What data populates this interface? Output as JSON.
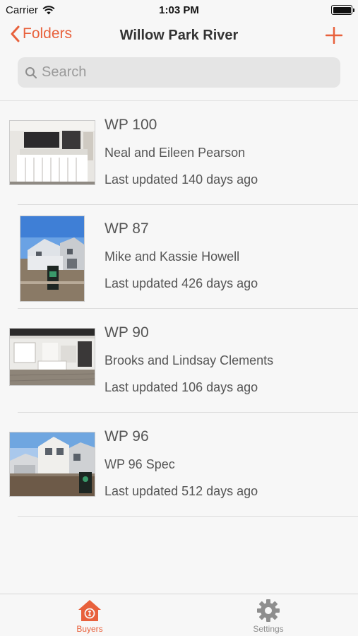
{
  "status_bar": {
    "carrier": "Carrier",
    "time": "1:03 PM"
  },
  "nav": {
    "back_label": "Folders",
    "title": "Willow Park River",
    "accent_color": "#e8613c"
  },
  "search": {
    "placeholder": "Search",
    "value": ""
  },
  "items": [
    {
      "title": "WP 100",
      "subtitle": "Neal and Eileen Pearson",
      "updated": "Last updated 140 days ago"
    },
    {
      "title": "WP 87",
      "subtitle": "Mike and Kassie Howell",
      "updated": "Last updated 426 days ago"
    },
    {
      "title": "WP 90",
      "subtitle": "Brooks and Lindsay Clements",
      "updated": "Last updated 106 days ago"
    },
    {
      "title": "WP 96",
      "subtitle": "WP 96 Spec",
      "updated": "Last updated 512 days ago"
    }
  ],
  "tabs": [
    {
      "label": "Buyers",
      "icon": "house-icon",
      "active": true
    },
    {
      "label": "Settings",
      "icon": "gear-icon",
      "active": false
    }
  ]
}
